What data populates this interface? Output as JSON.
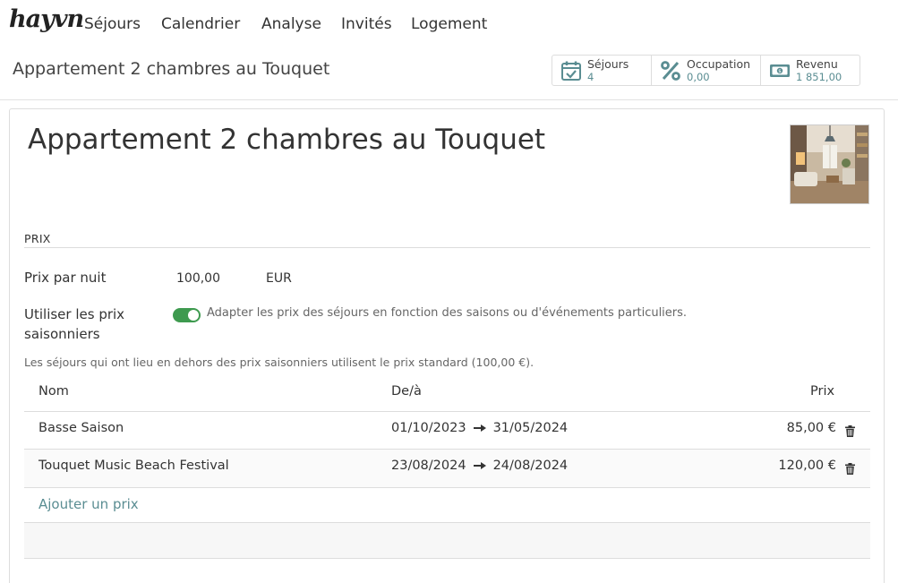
{
  "app": {
    "logo": "hayvn"
  },
  "nav": [
    "Séjours",
    "Calendrier",
    "Analyse",
    "Invités",
    "Logement"
  ],
  "header": {
    "title": "Appartement 2 chambres au Touquet",
    "stats": [
      {
        "icon": "calendar-check-icon",
        "label": "Séjours",
        "value": "4"
      },
      {
        "icon": "percent-icon",
        "label": "Occupation",
        "value": "0,00"
      },
      {
        "icon": "money-icon",
        "label": "Revenu",
        "value": "1 851,00"
      }
    ]
  },
  "listing": {
    "title": "Appartement 2 chambres au Touquet",
    "photo_icon": "apartment-photo"
  },
  "pricing": {
    "section_label": "PRIX",
    "nightly_label": "Prix par nuit",
    "nightly_value": "100,00",
    "currency": "EUR",
    "seasonal_label_line1": "Utiliser les prix",
    "seasonal_label_line2": "saisonniers",
    "seasonal_enabled": true,
    "seasonal_desc": "Adapter les prix des séjours en fonction des saisons ou d'événements particuliers.",
    "note": "Les séjours qui ont lieu en dehors des prix saisonniers utilisent le prix standard (100,00 €).",
    "table": {
      "headers": {
        "name": "Nom",
        "dates": "De/à",
        "price": "Prix"
      },
      "rows": [
        {
          "name": "Basse Saison",
          "from": "01/10/2023",
          "to": "31/05/2024",
          "price": "85,00 €"
        },
        {
          "name": "Touquet Music Beach Festival",
          "from": "23/08/2024",
          "to": "24/08/2024",
          "price": "120,00 €"
        }
      ]
    },
    "add_label": "Ajouter un prix"
  },
  "colors": {
    "accent": "#5a8d92",
    "toggle_on": "#3e9a4f"
  }
}
